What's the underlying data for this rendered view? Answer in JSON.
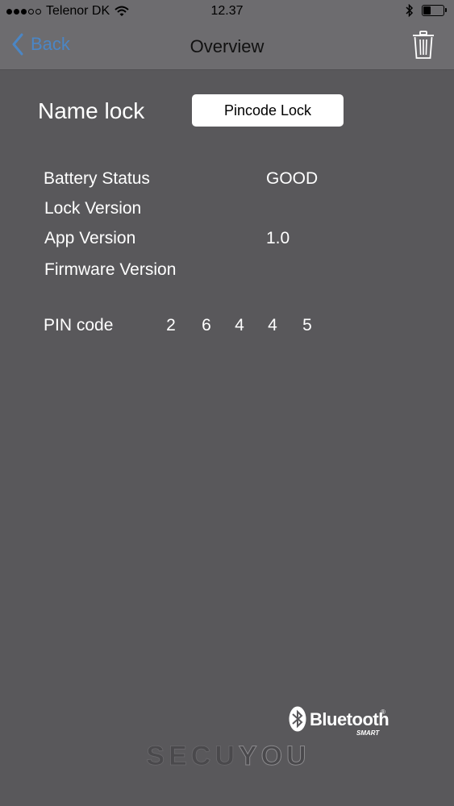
{
  "status_bar": {
    "carrier": "Telenor DK",
    "time": "12.37",
    "signal_bars_filled": 3,
    "signal_bars_total": 5,
    "battery_level": 0.35
  },
  "nav": {
    "back_label": "Back",
    "title": "Overview",
    "back_icon": "chevron-left-icon",
    "delete_icon": "trash-icon"
  },
  "lock": {
    "name_label": "Name lock",
    "name_value": "Pincode Lock"
  },
  "info": [
    {
      "key": "Battery Status",
      "value": "GOOD"
    },
    {
      "key": "Lock Version",
      "value": ""
    },
    {
      "key": "App Version",
      "value": "1.0"
    },
    {
      "key": "Firmware Version",
      "value": ""
    }
  ],
  "pin": {
    "label": "PIN code",
    "digits": [
      "2",
      "6",
      "4",
      "4",
      "5"
    ]
  },
  "footer": {
    "bluetooth_word": "Bluetooth",
    "bluetooth_reg": "®",
    "bluetooth_smart": "SMART",
    "brand_first": "SECU",
    "brand_second": "YOU"
  },
  "colors": {
    "background": "#59585b",
    "bars": "#6d6c6f",
    "accent": "#4b86c5"
  }
}
